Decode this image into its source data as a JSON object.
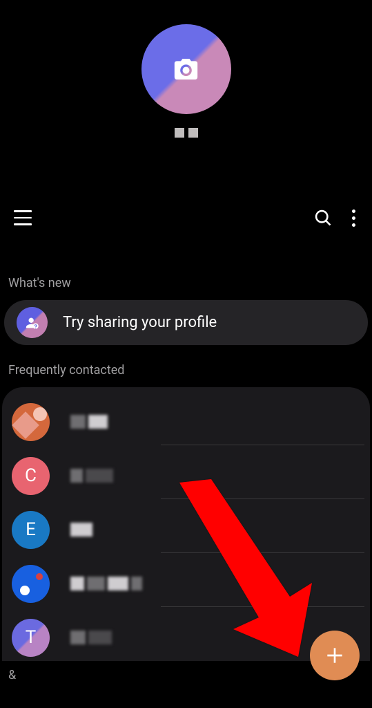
{
  "profile": {
    "name_parts": 2
  },
  "sections": {
    "whats_new": "What's new",
    "frequently": "Frequently contacted"
  },
  "whatsnew": {
    "text": "Try sharing your profile"
  },
  "contacts": [
    {
      "letter": "",
      "avatar_type": "img",
      "name_widths": [
        22,
        28
      ]
    },
    {
      "letter": "C",
      "avatar_type": "c",
      "name_widths": [
        18,
        40
      ]
    },
    {
      "letter": "E",
      "avatar_type": "e",
      "name_widths": [
        32
      ]
    },
    {
      "letter": "",
      "avatar_type": "p",
      "name_widths": [
        20,
        26,
        30,
        16
      ]
    },
    {
      "letter": "T",
      "avatar_type": "t",
      "name_widths": [
        22,
        34
      ]
    }
  ],
  "index_char": "&",
  "fab": {
    "icon": "plus"
  }
}
